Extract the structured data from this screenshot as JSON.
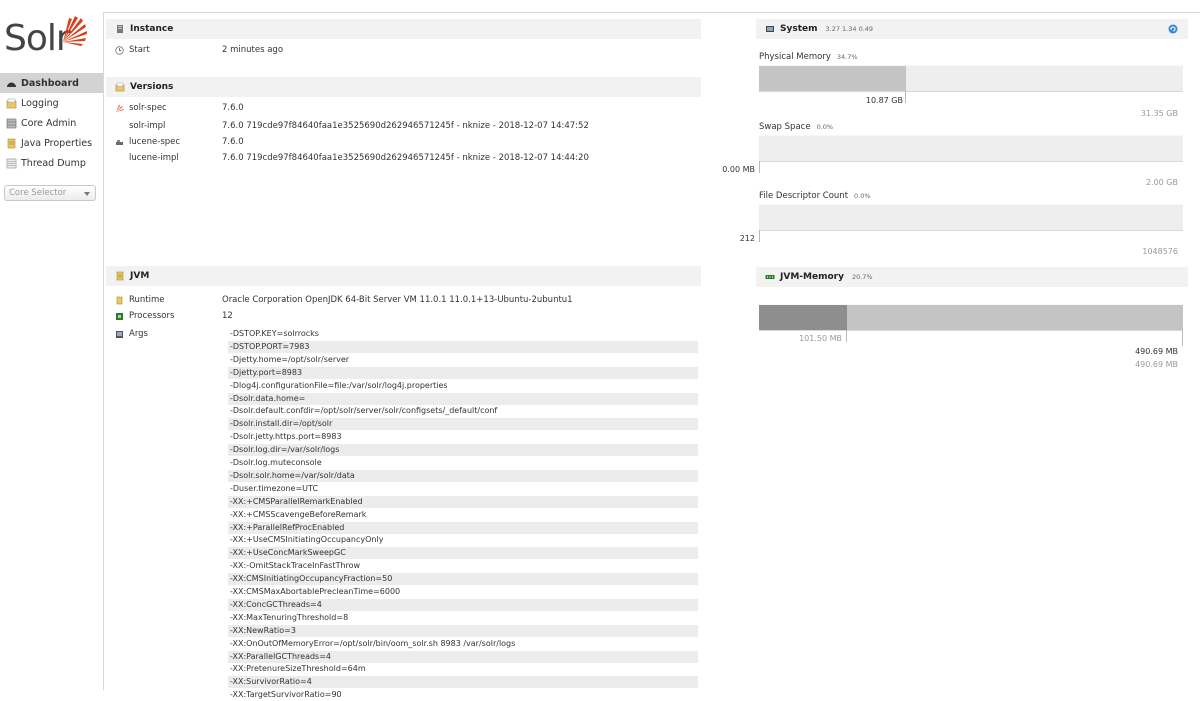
{
  "logo": {
    "text": "Solr"
  },
  "nav": [
    {
      "label": "Dashboard",
      "active": true
    },
    {
      "label": "Logging"
    },
    {
      "label": "Core Admin"
    },
    {
      "label": "Java Properties"
    },
    {
      "label": "Thread Dump"
    }
  ],
  "core_selector": {
    "placeholder": "Core Selector"
  },
  "instance": {
    "title": "Instance",
    "start_label": "Start",
    "start_value": "2 minutes ago"
  },
  "versions": {
    "title": "Versions",
    "rows": [
      {
        "key": "solr-spec",
        "value": "7.6.0"
      },
      {
        "key": "solr-impl",
        "value": "7.6.0 719cde97f84640faa1e3525690d262946571245f - nknize - 2018-12-07 14:47:52"
      },
      {
        "key": "lucene-spec",
        "value": "7.6.0"
      },
      {
        "key": "lucene-impl",
        "value": "7.6.0 719cde97f84640faa1e3525690d262946571245f - nknize - 2018-12-07 14:44:20"
      }
    ]
  },
  "jvm": {
    "title": "JVM",
    "runtime_label": "Runtime",
    "runtime_value": "Oracle Corporation OpenJDK 64-Bit Server VM 11.0.1 11.0.1+13-Ubuntu-2ubuntu1",
    "processors_label": "Processors",
    "processors_value": "12",
    "args_label": "Args",
    "args": [
      "-DSTOP.KEY=solrrocks",
      "-DSTOP.PORT=7983",
      "-Djetty.home=/opt/solr/server",
      "-Djetty.port=8983",
      "-Dlog4j.configurationFile=file:/var/solr/log4j.properties",
      "-Dsolr.data.home=",
      "-Dsolr.default.confdir=/opt/solr/server/solr/configsets/_default/conf",
      "-Dsolr.install.dir=/opt/solr",
      "-Dsolr.jetty.https.port=8983",
      "-Dsolr.log.dir=/var/solr/logs",
      "-Dsolr.log.muteconsole",
      "-Dsolr.solr.home=/var/solr/data",
      "-Duser.timezone=UTC",
      "-XX:+CMSParallelRemarkEnabled",
      "-XX:+CMSScavengeBeforeRemark",
      "-XX:+ParallelRefProcEnabled",
      "-XX:+UseCMSInitiatingOccupancyOnly",
      "-XX:+UseConcMarkSweepGC",
      "-XX:-OmitStackTraceInFastThrow",
      "-XX:CMSInitiatingOccupancyFraction=50",
      "-XX:CMSMaxAbortablePrecleanTime=6000",
      "-XX:ConcGCThreads=4",
      "-XX:MaxTenuringThreshold=8",
      "-XX:NewRatio=3",
      "-XX:OnOutOfMemoryError=/opt/solr/bin/oom_solr.sh 8983 /var/solr/logs",
      "-XX:ParallelGCThreads=4",
      "-XX:PretenureSizeThreshold=64m",
      "-XX:SurvivorRatio=4",
      "-XX:TargetSurvivorRatio=90"
    ]
  },
  "system": {
    "title": "System",
    "load": "3.27 1.34 0.49",
    "physical_memory": {
      "label": "Physical Memory",
      "pct": "34.7%",
      "used": "10.87 GB",
      "total": "31.35 GB",
      "fraction": 0.347
    },
    "swap_space": {
      "label": "Swap Space",
      "pct": "0.0%",
      "used": "0.00 MB",
      "total": "2.00 GB",
      "fraction": 0.0
    },
    "file_descriptor": {
      "label": "File Descriptor Count",
      "pct": "0.0%",
      "used": "212",
      "total": "1048576",
      "fraction": 0.0
    }
  },
  "jvm_memory": {
    "title": "JVM-Memory",
    "pct": "20.7%",
    "used": "101.50 MB",
    "committed": "490.69 MB",
    "max": "490.69 MB",
    "used_fraction": 0.207,
    "committed_fraction": 1.0
  },
  "colors": {
    "active_nav": "#d3d3d3",
    "section_header": "#f2f2f2",
    "bar_track": "#eeeeee",
    "bar_fill": "#c4c4c4",
    "bar_fill_dark": "#8e8e8e",
    "logo_accent": "#d9411e",
    "refresh": "#3a86d8"
  }
}
